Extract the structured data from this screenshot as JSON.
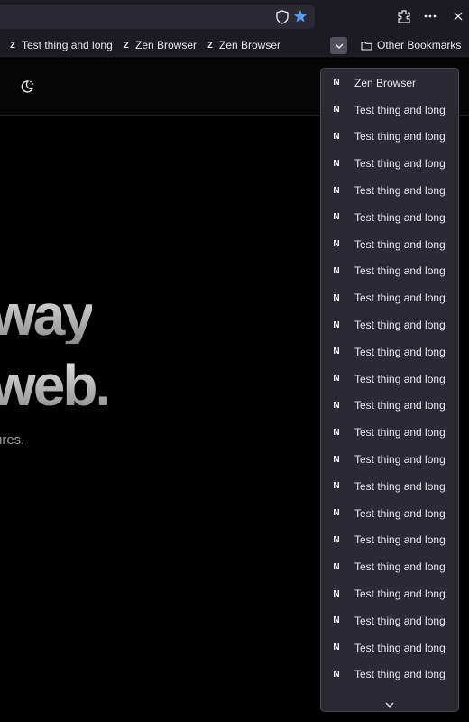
{
  "colors": {
    "toolbar_bg": "#1c1b22",
    "urlbar_bg": "#2b2a33",
    "menu_bg": "#2b2a33",
    "star_accent": "#5b9cf6",
    "page_bg": "#000000"
  },
  "toolbar": {
    "icons": [
      "shield-icon",
      "bookmark-star-icon",
      "extensions-icon",
      "more-menu-icon",
      "close-icon"
    ]
  },
  "bookmarks_bar": {
    "items": [
      {
        "label": "Test thing and long",
        "icon": "zen-logo-icon"
      },
      {
        "label": "Zen Browser",
        "icon": "zen-logo-icon"
      },
      {
        "label": "Zen Browser",
        "icon": "zen-logo-icon"
      }
    ],
    "overflow_icon": "chevron-down-icon",
    "other_bookmarks_label": "Other Bookmarks"
  },
  "page": {
    "hero_line_1": "way",
    "hero_line_2": "web.",
    "subtitle": "ures."
  },
  "overflow_menu": {
    "items": [
      "Zen Browser",
      "Test thing and long",
      "Test thing and long",
      "Test thing and long",
      "Test thing and long",
      "Test thing and long",
      "Test thing and long",
      "Test thing and long",
      "Test thing and long",
      "Test thing and long",
      "Test thing and long",
      "Test thing and long",
      "Test thing and long",
      "Test thing and long",
      "Test thing and long",
      "Test thing and long",
      "Test thing and long",
      "Test thing and long",
      "Test thing and long",
      "Test thing and long",
      "Test thing and long",
      "Test thing and long",
      "Test thing and long",
      "Test thing and long"
    ],
    "scroll_icon": "chevron-down-icon"
  }
}
